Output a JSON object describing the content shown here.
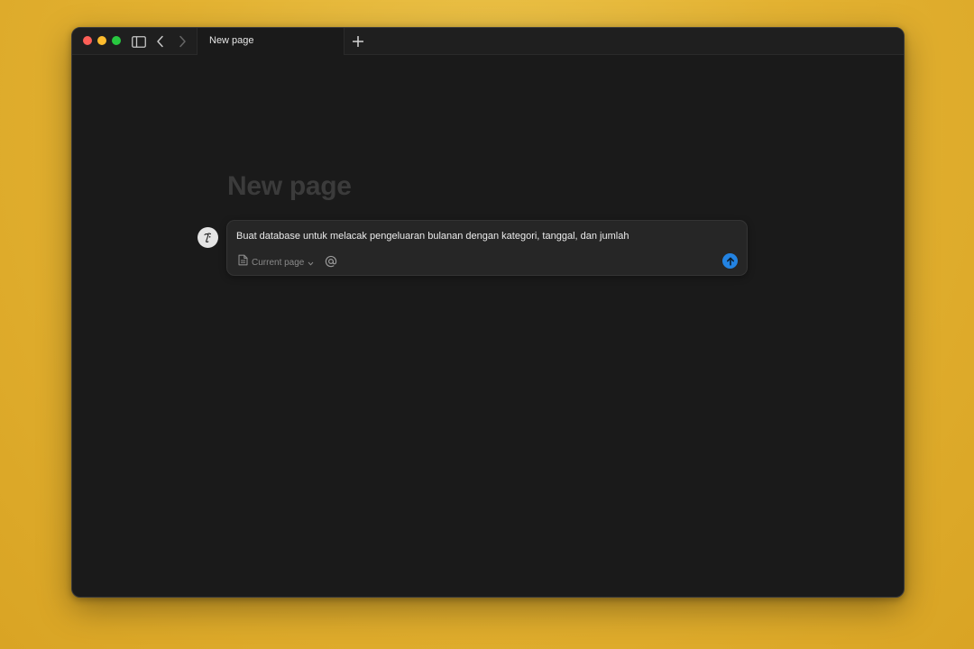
{
  "window": {
    "traffic_lights": {
      "close_color": "#fe5f57",
      "minimize_color": "#febc2e",
      "maximize_color": "#28c840"
    },
    "toolbar_icons": [
      "sidebar-toggle-icon",
      "back-arrow-icon",
      "forward-arrow-icon",
      "plus-icon"
    ]
  },
  "tabs": [
    {
      "label": "New page",
      "active": true
    }
  ],
  "page": {
    "title": "New page"
  },
  "composer": {
    "avatar_icon": "ai-face-icon",
    "prompt_text": "Buat database untuk melacak pengeluaran bulanan dengan kategori, tanggal, dan jumlah",
    "context_label": "Current page",
    "context_icon": "document-icon",
    "mention_icon": "at-icon",
    "send_icon": "arrow-up-icon",
    "send_color": "#2383e2"
  }
}
